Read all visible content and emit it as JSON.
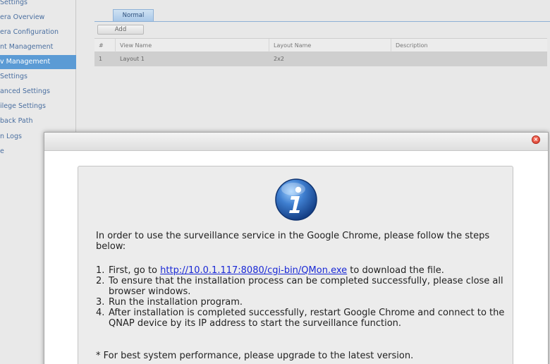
{
  "sidebar": {
    "items": [
      {
        "label": "Settings",
        "active": false
      },
      {
        "label": "era Overview",
        "active": false
      },
      {
        "label": "era Configuration",
        "active": false
      },
      {
        "label": "nt Management",
        "active": false
      },
      {
        "label": "v Management",
        "active": true
      },
      {
        "label": "Settings",
        "active": false
      },
      {
        "label": "anced Settings",
        "active": false
      },
      {
        "label": "ilege Settings",
        "active": false
      },
      {
        "label": "back Path",
        "active": false
      },
      {
        "label": "n Logs",
        "active": false
      },
      {
        "label": "e",
        "active": false
      }
    ]
  },
  "main": {
    "tab_label": "Normal",
    "add_label": "Add",
    "columns": [
      "#",
      "View Name",
      "Layout Name",
      "Description"
    ],
    "rows": [
      {
        "num": "1",
        "view_name": "Layout 1",
        "layout_name": "2x2",
        "description": ""
      }
    ]
  },
  "dialog": {
    "intro": "In order to use the surveillance service in the Google Chrome, please follow the steps below:",
    "step1": {
      "num": "1.",
      "before": "First, go to ",
      "link": "http://10.0.1.117:8080/cgi-bin/QMon.exe",
      "after": " to download the file."
    },
    "step2": {
      "num": "2.",
      "text": "To ensure that the installation process can be completed successfully, please close all browser windows."
    },
    "step3": {
      "num": "3.",
      "text": "Run the installation program."
    },
    "step4": {
      "num": "4.",
      "text": "After installation is completed successfully, restart Google Chrome and connect to the QNAP device by its IP address to start the surveillance function."
    },
    "note": "* For best system performance, please upgrade to the latest version.",
    "info_icon": "info-icon",
    "close_icon": "close-icon"
  },
  "colors": {
    "accent": "#5b9bd5",
    "link": "#1a29d6",
    "close": "#d23a2a"
  }
}
